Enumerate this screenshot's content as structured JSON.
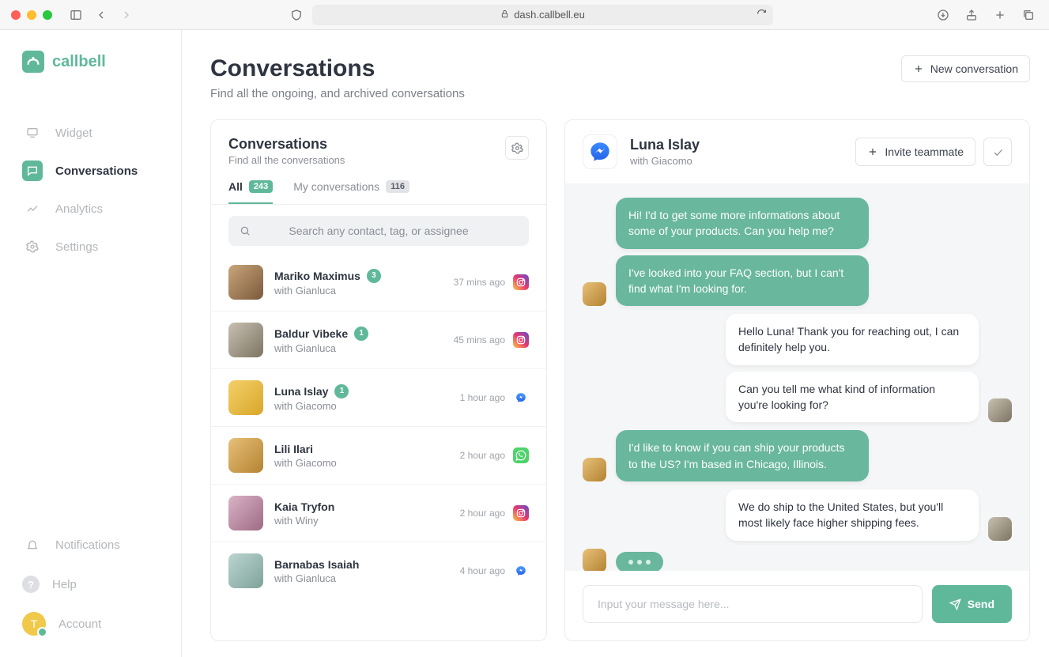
{
  "browser": {
    "url": "dash.callbell.eu"
  },
  "brand": {
    "name": "callbell"
  },
  "sidebar": {
    "items": [
      {
        "label": "Widget"
      },
      {
        "label": "Conversations"
      },
      {
        "label": "Analytics"
      },
      {
        "label": "Settings"
      }
    ],
    "bottom": [
      {
        "label": "Notifications"
      },
      {
        "label": "Help"
      },
      {
        "label": "Account",
        "avatar_initial": "T"
      }
    ]
  },
  "page": {
    "title": "Conversations",
    "subtitle": "Find all the ongoing, and archived conversations",
    "new_button": "New conversation"
  },
  "list_panel": {
    "title": "Conversations",
    "subtitle": "Find all the conversations",
    "tab_all": "All",
    "tab_all_count": "243",
    "tab_mine": "My conversations",
    "tab_mine_count": "116",
    "search_placeholder": "Search any contact, tag, or assignee",
    "items": [
      {
        "name": "Mariko Maximus",
        "with": "with Gianluca",
        "count": "3",
        "time": "37 mins ago",
        "channel": "instagram"
      },
      {
        "name": "Baldur Vibeke",
        "with": "with Gianluca",
        "count": "1",
        "time": "45 mins ago",
        "channel": "instagram"
      },
      {
        "name": "Luna Islay",
        "with": "with Giacomo",
        "count": "1",
        "time": "1 hour ago",
        "channel": "messenger"
      },
      {
        "name": "Lili Ilari",
        "with": "with Giacomo",
        "count": "",
        "time": "2 hour ago",
        "channel": "whatsapp"
      },
      {
        "name": "Kaia Tryfon",
        "with": "with Winy",
        "count": "",
        "time": "2 hour ago",
        "channel": "instagram"
      },
      {
        "name": "Barnabas Isaiah",
        "with": "with Gianluca",
        "count": "",
        "time": "4 hour ago",
        "channel": "messenger"
      }
    ]
  },
  "chat": {
    "title": "Luna Islay",
    "subtitle": "with Giacomo",
    "invite_label": "Invite teammate",
    "messages": [
      {
        "side": "in",
        "text": "Hi! I'd to get some more informations about some of your products. Can you help me?"
      },
      {
        "side": "in",
        "text": "I've looked into your FAQ section, but I can't find what I'm looking for."
      },
      {
        "side": "out",
        "text": "Hello Luna! Thank you for reaching out, I can definitely help you."
      },
      {
        "side": "out",
        "text": "Can you tell me what kind of information you're looking for?"
      },
      {
        "side": "in",
        "text": "I'd like to know if you can ship your products to the US? I'm based in Chicago, Illinois."
      },
      {
        "side": "out",
        "text": "We do ship to the United States, but you'll most likely face higher shipping fees."
      }
    ],
    "composer_placeholder": "Input your message here...",
    "send_label": "Send"
  }
}
